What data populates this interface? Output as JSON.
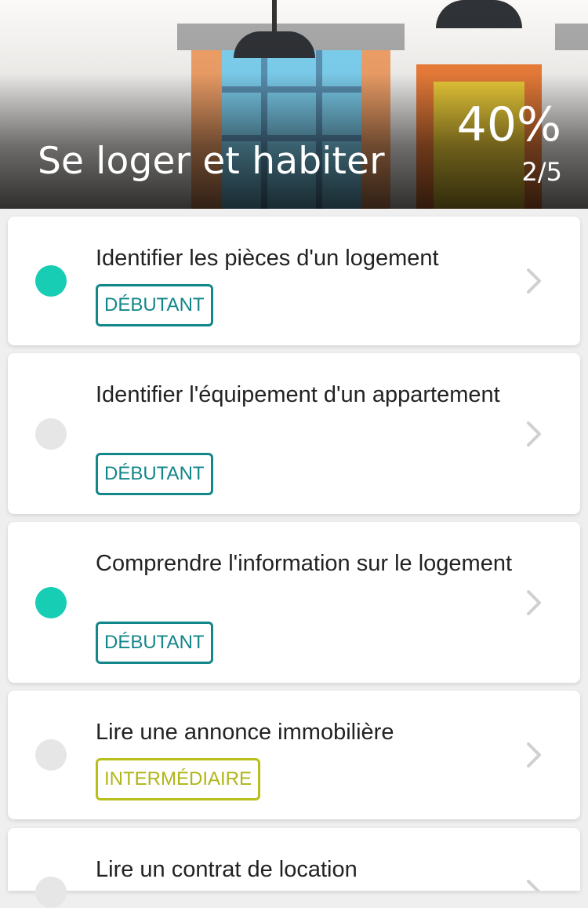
{
  "header": {
    "title": "Se loger et habiter",
    "percent": "40%",
    "count": "2/5"
  },
  "lessons": [
    {
      "title": "Identifier les pièces d'un logement",
      "level": "DÉBUTANT",
      "completed": true
    },
    {
      "title": "Identifier l'équipement d'un appartement",
      "level": "DÉBUTANT",
      "completed": false
    },
    {
      "title": "Comprendre l'information sur le logement",
      "level": "DÉBUTANT",
      "completed": true
    },
    {
      "title": "Lire une annonce immobilière",
      "level": "INTERMÉDIAIRE",
      "completed": false
    },
    {
      "title": "Lire un contrat de location",
      "level": "",
      "completed": false
    }
  ],
  "colors": {
    "completed_dot": "#17cdb4",
    "pending_dot": "#e6e6e6",
    "beginner": "#13868a",
    "intermediate": "#b8bf1c"
  },
  "icons": {
    "chevron": "chevron-right-icon"
  }
}
